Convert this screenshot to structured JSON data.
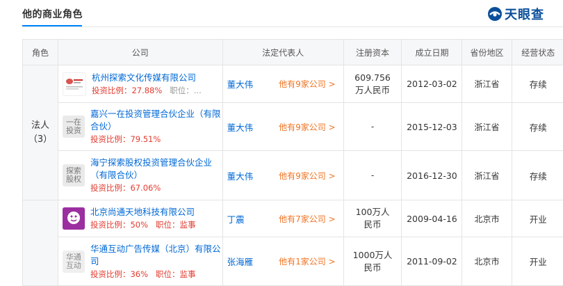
{
  "header": {
    "title": "他的商业角色",
    "brand": "天眼查"
  },
  "table": {
    "columns": [
      "角色",
      "公司",
      "法定代表人",
      "注册资本",
      "成立日期",
      "省份地区",
      "经营状态"
    ],
    "groups": [
      {
        "role": "法人",
        "count": "（3）"
      }
    ],
    "rows": [
      {
        "logo_text": "杭州探索文化传媒",
        "logo_kind": "image",
        "name": "杭州探索文化传媒有限公司",
        "stake_label": "投资比例：",
        "stake": "27.88%",
        "pos_label": "职位：",
        "pos": "...",
        "rep": "董大伟",
        "rep_more": "他有9家公司 >",
        "capital": "609.756\n万人民币",
        "date": "2012-03-02",
        "region": "浙江省",
        "status": "存续"
      },
      {
        "logo_text": "一在\n投资",
        "logo_kind": "gray",
        "name": "嘉兴一在投资管理合伙企业（有限合伙）",
        "stake_label": "投资比例：",
        "stake": "79.51%",
        "rep": "董大伟",
        "rep_more": "他有9家公司 >",
        "capital": "-",
        "date": "2015-12-03",
        "region": "浙江省",
        "status": "存续"
      },
      {
        "logo_text": "探索\n股权",
        "logo_kind": "gray",
        "name": "海宁探索股权投资管理合伙企业（有限合伙）",
        "stake_label": "投资比例：",
        "stake": "67.06%",
        "rep": "董大伟",
        "rep_more": "他有9家公司 >",
        "capital": "-",
        "date": "2016-12-30",
        "region": "浙江省",
        "status": "存续"
      },
      {
        "logo_text": "",
        "logo_kind": "purple",
        "name": "北京尚通天地科技有限公司",
        "stake_label": "投资比例：",
        "stake": "50%",
        "pos_label": "职位：",
        "pos": "监事",
        "rep": "丁震",
        "rep_more": "他有7家公司 >",
        "capital": "100万人\n民币",
        "date": "2009-04-16",
        "region": "北京市",
        "status": "开业"
      },
      {
        "logo_text": "华通\n互动",
        "logo_kind": "gray",
        "name": "华通互动广告传媒（北京）有限公司",
        "stake_label": "投资比例：",
        "stake": "36%",
        "pos_label": "职位：",
        "pos": "监事",
        "rep": "张海雁",
        "rep_more": "他有1家公司 >",
        "capital": "1000万人\n民币",
        "date": "2011-09-02",
        "region": "北京市",
        "status": "开业"
      }
    ]
  },
  "colors": {
    "link": "#0068d6",
    "stake": "#e23b2f",
    "more": "#f07423",
    "status": "#3aaa35",
    "header_bg": "#f6f7f9",
    "accent": "#0084ff"
  }
}
